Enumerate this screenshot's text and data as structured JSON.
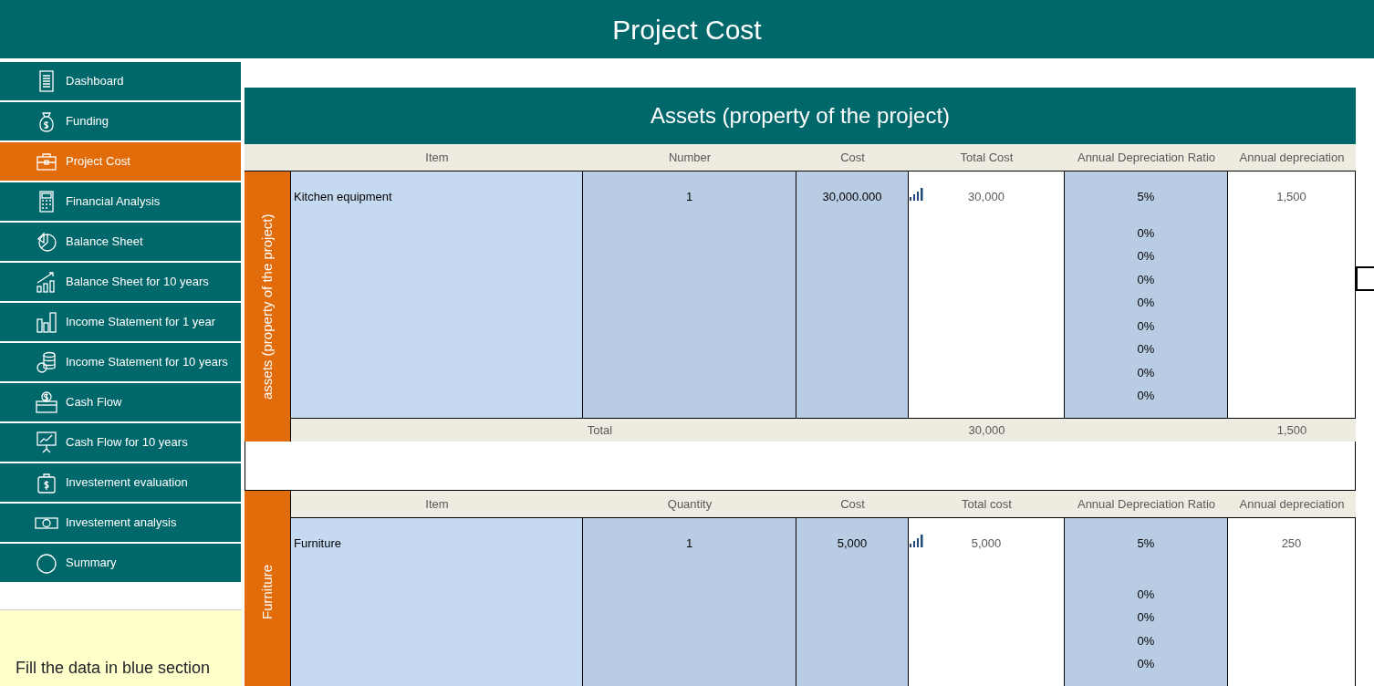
{
  "header": {
    "title": "Project Cost"
  },
  "sidebar": {
    "items": [
      {
        "label": "Dashboard",
        "selected": false
      },
      {
        "label": "Funding",
        "selected": false
      },
      {
        "label": "Project Cost",
        "selected": true
      },
      {
        "label": "Financial Analysis",
        "selected": false
      },
      {
        "label": "Balance Sheet",
        "selected": false
      },
      {
        "label": "Balance Sheet for 10 years",
        "selected": false
      },
      {
        "label": "Income Statement for 1 year",
        "selected": false
      },
      {
        "label": "Income Statement for 10 years",
        "selected": false
      },
      {
        "label": "Cash Flow",
        "selected": false
      },
      {
        "label": "Cash Flow for 10 years",
        "selected": false
      },
      {
        "label": "Investement evaluation",
        "selected": false
      },
      {
        "label": "Investement analysis",
        "selected": false
      },
      {
        "label": "Summary",
        "selected": false
      }
    ]
  },
  "note": "Fill the data in blue section",
  "sections": [
    {
      "title": "Assets (property of the project)",
      "side_label": "assets (property of the project)",
      "label_spans_header": false,
      "columns": [
        "Item",
        "Number",
        "Cost",
        "Total Cost",
        "Annual Depreciation Ratio",
        "Annual depreciation"
      ],
      "rows": [
        {
          "item": "Kitchen equipment",
          "number": "1",
          "cost": "30,000.000",
          "total_cost": "30,000",
          "ratios": [
            "5%",
            "0%",
            "0%",
            "0%",
            "0%",
            "0%",
            "0%",
            "0%",
            "0%"
          ],
          "annual_depreciation": "1,500"
        }
      ],
      "total": {
        "label": "Total",
        "total_cost": "30,000",
        "annual_depreciation": "1,500"
      }
    },
    {
      "side_label": "Furniture",
      "label_spans_header": true,
      "columns": [
        "Item",
        "Quantity",
        "Cost",
        "Total cost",
        "Annual Depreciation Ratio",
        "Annual depreciation"
      ],
      "rows": [
        {
          "item": "Furniture",
          "number": "1",
          "cost": "5,000",
          "total_cost": "5,000",
          "ratios": [
            "5%",
            "0%",
            "0%",
            "0%",
            "0%"
          ],
          "annual_depreciation": "250"
        }
      ]
    }
  ]
}
